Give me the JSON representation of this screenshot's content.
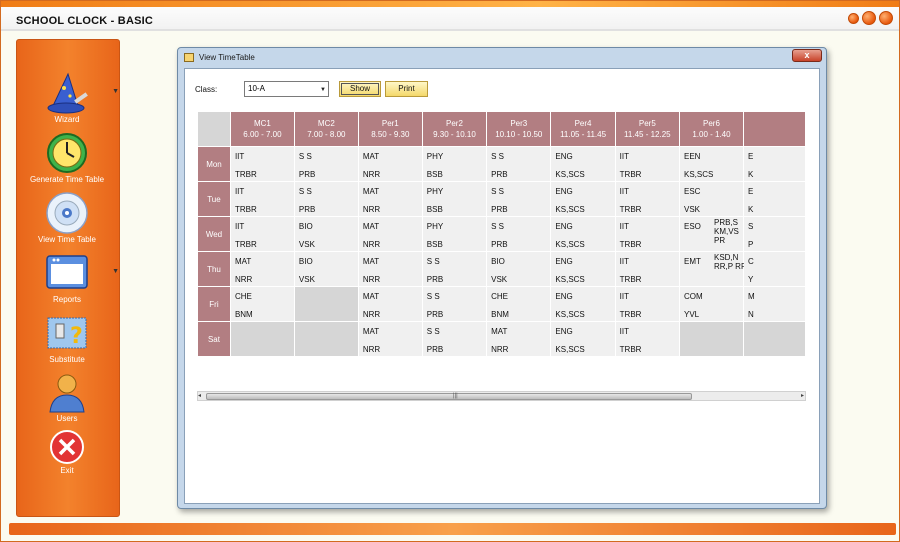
{
  "app": {
    "title": "SCHOOL CLOCK - BASIC"
  },
  "sidebar": {
    "items": [
      {
        "label": "Wizard",
        "icon": "wizard-hat-icon"
      },
      {
        "label": "Generate Time Table",
        "icon": "clock-icon"
      },
      {
        "label": "View Time Table",
        "icon": "disc-icon"
      },
      {
        "label": "Reports",
        "icon": "window-icon"
      },
      {
        "label": "Substitute",
        "icon": "substitute-icon"
      },
      {
        "label": "Users",
        "icon": "user-icon"
      },
      {
        "label": "Exit",
        "icon": "exit-icon"
      }
    ]
  },
  "dialog": {
    "title": "View TimeTable",
    "close_label": "x",
    "class_label": "Class:",
    "class_value": "10-A",
    "show_label": "Show",
    "print_label": "Print"
  },
  "timetable": {
    "columns": [
      {
        "name": "MC1",
        "time": "6.00 - 7.00"
      },
      {
        "name": "MC2",
        "time": "7.00 - 8.00"
      },
      {
        "name": "Per1",
        "time": "8.50 - 9.30"
      },
      {
        "name": "Per2",
        "time": "9.30 - 10.10"
      },
      {
        "name": "Per3",
        "time": "10.10 - 10.50"
      },
      {
        "name": "Per4",
        "time": "11.05 - 11.45"
      },
      {
        "name": "Per5",
        "time": "11.45 - 12.25"
      },
      {
        "name": "Per6",
        "time": "1.00 - 1.40"
      },
      {
        "name": "",
        "time": ""
      }
    ],
    "rows": [
      {
        "day": "Mon",
        "cells": [
          [
            "IIT",
            "TRBR"
          ],
          [
            "S S",
            "PRB"
          ],
          [
            "MAT",
            "NRR"
          ],
          [
            "PHY",
            "BSB"
          ],
          [
            "S S",
            "PRB"
          ],
          [
            "ENG",
            "KS,SCS"
          ],
          [
            "IIT",
            "TRBR"
          ],
          [
            "EEN",
            "KS,SCS"
          ],
          [
            "E",
            "K"
          ]
        ]
      },
      {
        "day": "Tue",
        "cells": [
          [
            "IIT",
            "TRBR"
          ],
          [
            "S S",
            "PRB"
          ],
          [
            "MAT",
            "NRR"
          ],
          [
            "PHY",
            "BSB"
          ],
          [
            "S S",
            "PRB"
          ],
          [
            "ENG",
            "KS,SCS"
          ],
          [
            "IIT",
            "TRBR"
          ],
          [
            "ESC",
            "VSK"
          ],
          [
            "E",
            "K"
          ]
        ]
      },
      {
        "day": "Wed",
        "cells": [
          [
            "IIT",
            "TRBR"
          ],
          [
            "BIO",
            "VSK"
          ],
          [
            "MAT",
            "NRR"
          ],
          [
            "PHY",
            "BSB"
          ],
          [
            "S S",
            "PRB"
          ],
          [
            "ENG",
            "KS,SCS"
          ],
          [
            "IIT",
            "TRBR"
          ],
          [
            "ESO",
            "",
            "PRB,S KM,VS PR"
          ],
          [
            "S",
            "P"
          ]
        ]
      },
      {
        "day": "Thu",
        "cells": [
          [
            "MAT",
            "NRR"
          ],
          [
            "BIO",
            "VSK"
          ],
          [
            "MAT",
            "NRR"
          ],
          [
            "S S",
            "PRB"
          ],
          [
            "BIO",
            "VSK"
          ],
          [
            "ENG",
            "KS,SCS"
          ],
          [
            "IIT",
            "TRBR"
          ],
          [
            "EMT",
            "",
            "KSD,N RR,P RR"
          ],
          [
            "C",
            "Y"
          ]
        ]
      },
      {
        "day": "Fri",
        "cells": [
          [
            "CHE",
            "BNM"
          ],
          null,
          [
            "MAT",
            "NRR"
          ],
          [
            "S S",
            "PRB"
          ],
          [
            "CHE",
            "BNM"
          ],
          [
            "ENG",
            "KS,SCS"
          ],
          [
            "IIT",
            "TRBR"
          ],
          [
            "COM",
            "YVL"
          ],
          [
            "M",
            "N"
          ]
        ]
      },
      {
        "day": "Sat",
        "cells": [
          null,
          null,
          [
            "MAT",
            "NRR"
          ],
          [
            "S S",
            "PRB"
          ],
          [
            "MAT",
            "NRR"
          ],
          [
            "ENG",
            "KS,SCS"
          ],
          [
            "IIT",
            "TRBR"
          ],
          null,
          null
        ]
      }
    ]
  },
  "colors": {
    "accent": "#ee6f1f",
    "header": "#b27e82",
    "cell": "#f0f0f0",
    "empty": "#d6d6d6",
    "button": "#f4d86a"
  }
}
